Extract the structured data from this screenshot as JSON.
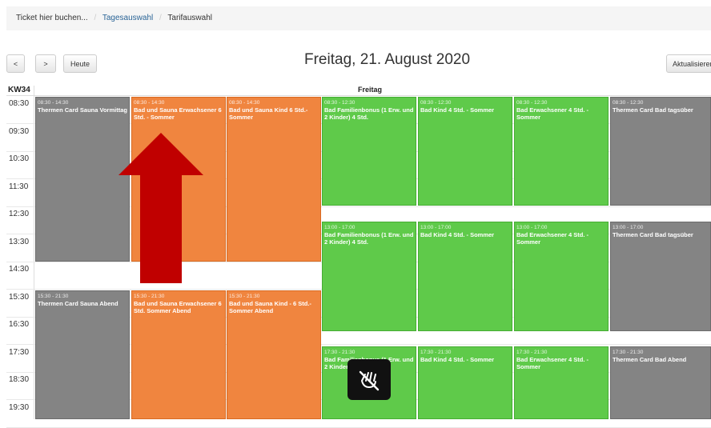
{
  "breadcrumb": {
    "item1": "Ticket hier buchen...",
    "item2": "Tagesauswahl",
    "item3": "Tarifauswahl",
    "separator": "/"
  },
  "toolbar": {
    "prev_label": "<",
    "next_label": ">",
    "today_label": "Heute",
    "refresh_label": "Aktualisieren"
  },
  "calendar": {
    "title": "Freitag, 21. August 2020",
    "week_label": "KW34",
    "day_header": "Freitag",
    "times": [
      "08:30",
      "09:30",
      "10:30",
      "11:30",
      "12:30",
      "13:30",
      "14:30",
      "15:30",
      "16:30",
      "17:30",
      "18:30",
      "19:30"
    ],
    "events": [
      {
        "time": "08:30 - 14:30",
        "name": "Thermen Card Sauna Vormittag",
        "color": "#848484"
      },
      {
        "time": "08:30 - 14:30",
        "name": "Bad und Sauna Erwachsener 6 Std. - Sommer",
        "color": "#f0853f"
      },
      {
        "time": "08:30 - 14:30",
        "name": "Bad und Sauna Kind 6 Std.-Sommer",
        "color": "#f0853f"
      },
      {
        "time": "08:30 - 12:30",
        "name": "Bad Familienbonus (1 Erw. und 2 Kinder) 4 Std.",
        "color": "#5fca4a"
      },
      {
        "time": "08:30 - 12:30",
        "name": "Bad Kind 4 Std. - Sommer",
        "color": "#5fca4a"
      },
      {
        "time": "08:30 - 12:30",
        "name": "Bad Erwachsener 4 Std. - Sommer",
        "color": "#5fca4a"
      },
      {
        "time": "08:30 - 12:30",
        "name": "Thermen Card Bad tagsüber",
        "color": "#848484"
      },
      {
        "time": "13:00 - 17:00",
        "name": "Bad Familienbonus (1 Erw. und 2 Kinder) 4 Std.",
        "color": "#5fca4a"
      },
      {
        "time": "13:00 - 17:00",
        "name": "Bad Kind 4 Std. - Sommer",
        "color": "#5fca4a"
      },
      {
        "time": "13:00 - 17:00",
        "name": "Bad Erwachsener 4 Std. - Sommer",
        "color": "#5fca4a"
      },
      {
        "time": "13:00 - 17:00",
        "name": "Thermen Card Bad tagsüber",
        "color": "#848484"
      },
      {
        "time": "15:30 - 21:30",
        "name": "Thermen Card Sauna Abend",
        "color": "#848484"
      },
      {
        "time": "15:30 - 21:30",
        "name": "Bad und Sauna Erwachsener 6 Std. Sommer Abend",
        "color": "#f0853f"
      },
      {
        "time": "15:30 - 21:30",
        "name": "Bad und Sauna Kind - 6 Std.-Sommer Abend",
        "color": "#f0853f"
      },
      {
        "time": "17:30 - 21:30",
        "name": "Bad Familienbonus (1 Erw. und 2 Kinder",
        "color": "#5fca4a"
      },
      {
        "time": "17:30 - 21:30",
        "name": "Bad Kind 4 Std. - Sommer",
        "color": "#5fca4a"
      },
      {
        "time": "17:30 - 21:30",
        "name": "Bad Erwachsener 4 Std. - Sommer",
        "color": "#5fca4a"
      },
      {
        "time": "17:30 - 21:30",
        "name": "Thermen Card Bad Abend",
        "color": "#848484"
      }
    ]
  },
  "annotation": {
    "arrow_color": "#c00000",
    "icon": "no-touch-hand-icon"
  }
}
